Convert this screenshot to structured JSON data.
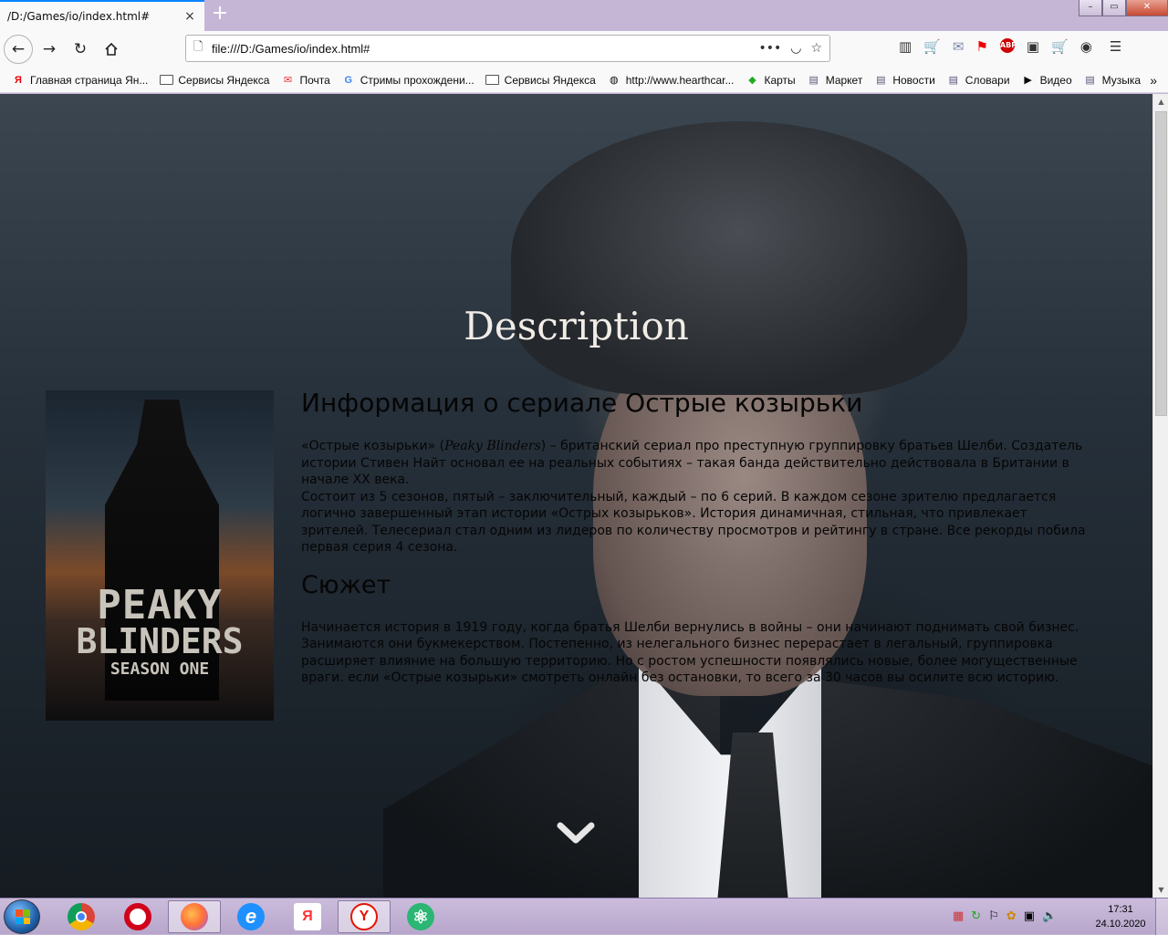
{
  "browser": {
    "tab_title": "/D:/Games/io/index.html#",
    "tab_close": "×",
    "new_tab": "+",
    "window_controls": [
      "–",
      "▭",
      "✕"
    ],
    "url": "file:///D:/Games/io/index.html#",
    "nav_icons": [
      "back-arrow-icon",
      "forward-arrow-icon",
      "reload-icon",
      "home-icon"
    ]
  },
  "bookmarks": [
    {
      "label": "Главная страница Ян...",
      "icon": "yandex-icon"
    },
    {
      "label": "Сервисы Яндекса",
      "icon": "folder-icon"
    },
    {
      "label": "Почта",
      "icon": "mail-icon"
    },
    {
      "label": "Стримы прохождени...",
      "icon": "google-icon"
    },
    {
      "label": "Сервисы Яндекса",
      "icon": "folder-icon"
    },
    {
      "label": "http://www.hearthcar...",
      "icon": "globe-icon"
    },
    {
      "label": "Карты",
      "icon": "maps-icon"
    },
    {
      "label": "Маркет",
      "icon": "page-icon"
    },
    {
      "label": "Новости",
      "icon": "page-icon"
    },
    {
      "label": "Словари",
      "icon": "page-icon"
    },
    {
      "label": "Видео",
      "icon": "video-icon"
    },
    {
      "label": "Музыка",
      "icon": "page-icon"
    }
  ],
  "bookmarks_more": "»",
  "page": {
    "title": "Description",
    "poster": {
      "line1": "PEAKY",
      "line2": "BLINDERS",
      "line3": "SEASON ONE"
    },
    "heading": "Информация о сериале Острые козырьки",
    "paragraph1_part1": "«Острые козырьки» (",
    "paragraph1_italic": "Peaky Blinders",
    "paragraph1_part2": ") – британский сериал про преступную группировку братьев Шелби. Создатель истории Стивен Найт основал ее на реальных событиях – такая банда действительно действовала в Британии в начале XX века.",
    "paragraph1_line2": "Состоит из 5 сезонов, пятый – заключительный, каждый – по 6 серий. В каждом сезоне зрителю предлагается логично завершенный этап истории «Острых козырьков». История динамичная, стильная, что привлекает зрителей. Телесериал стал одним из лидеров по количеству просмотров и рейтингу в стране. Все рекорды побила первая серия 4 сезона.",
    "subheading": "Сюжет",
    "paragraph2": "Начинается история в 1919 году, когда братья Шелби вернулись в войны – они начинают поднимать свой бизнес. Занимаются они букмекерством. Постепенно, из нелегального бизнес перерастает в легальный, группировка расширяет влияние на большую территорию. Но с ростом успешности появлялись новые, более могущественные враги. если «Острые козырьки» смотреть онлайн без остановки, то всего за 30 часов вы осилите всю историю."
  },
  "taskbar": {
    "apps": [
      {
        "name": "chrome",
        "letter": "",
        "color": "#e8453c"
      },
      {
        "name": "opera",
        "letter": "O",
        "color": "#d0021b"
      },
      {
        "name": "firefox",
        "letter": "",
        "color": "#ff7139"
      },
      {
        "name": "internet-explorer",
        "letter": "e",
        "color": "#1e90ff"
      },
      {
        "name": "yandex",
        "letter": "Я",
        "color": "#f33"
      },
      {
        "name": "yandex-browser",
        "letter": "Y",
        "color": "#e61400"
      },
      {
        "name": "atom",
        "letter": "⚛",
        "color": "#2bb673"
      }
    ],
    "time": "17:31",
    "date": "24.10.2020"
  }
}
